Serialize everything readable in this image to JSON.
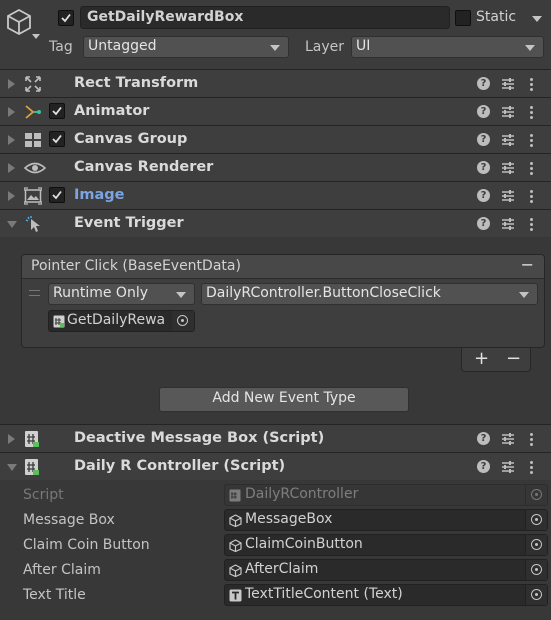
{
  "header": {
    "active": true,
    "object_name": "GetDailyRewardBox",
    "static_label": "Static",
    "static_checked": false,
    "tag_label": "Tag",
    "tag_value": "Untagged",
    "layer_label": "Layer",
    "layer_value": "UI"
  },
  "components": [
    {
      "title": "Rect Transform",
      "icon": "rect-transform-icon",
      "has_checkbox": false,
      "expanded": false
    },
    {
      "title": "Animator",
      "icon": "animator-icon",
      "has_checkbox": true,
      "checked": true,
      "expanded": false
    },
    {
      "title": "Canvas Group",
      "icon": "canvas-group-icon",
      "has_checkbox": true,
      "checked": true,
      "expanded": false
    },
    {
      "title": "Canvas Renderer",
      "icon": "eye-icon",
      "has_checkbox": false,
      "expanded": false
    },
    {
      "title": "Image",
      "icon": "image-icon",
      "has_checkbox": true,
      "checked": true,
      "expanded": false,
      "title_color": "#7ba4e0"
    },
    {
      "title": "Event Trigger",
      "icon": "event-trigger-icon",
      "has_checkbox": false,
      "expanded": true
    }
  ],
  "event_trigger": {
    "event_title": "Pointer Click (BaseEventData)",
    "remove_event_symbol": "−",
    "runtime_option": "Runtime Only",
    "function_value": "DailyRController.ButtonCloseClick",
    "target_object": "GetDailyRewa",
    "add_symbol": "+",
    "remove_symbol": "−",
    "add_event_type_label": "Add New Event Type"
  },
  "deactive_component": {
    "title": "Deactive Message Box (Script)",
    "icon": "script-icon",
    "expanded": false
  },
  "controller_component": {
    "title": "Daily R Controller (Script)",
    "icon": "script-icon",
    "expanded": true,
    "fields": [
      {
        "label": "Script",
        "value": "DailyRController",
        "icon": "script-icon",
        "disabled": true
      },
      {
        "label": "Message Box",
        "value": "MessageBox",
        "icon": "gameobject-icon",
        "disabled": false
      },
      {
        "label": "Claim Coin Button",
        "value": "ClaimCoinButton",
        "icon": "gameobject-icon",
        "disabled": false
      },
      {
        "label": "After Claim",
        "value": "AfterClaim",
        "icon": "gameobject-icon",
        "disabled": false
      },
      {
        "label": "Text Title",
        "value": "TextTitleContent (Text)",
        "icon": "text-icon",
        "disabled": false
      }
    ]
  }
}
